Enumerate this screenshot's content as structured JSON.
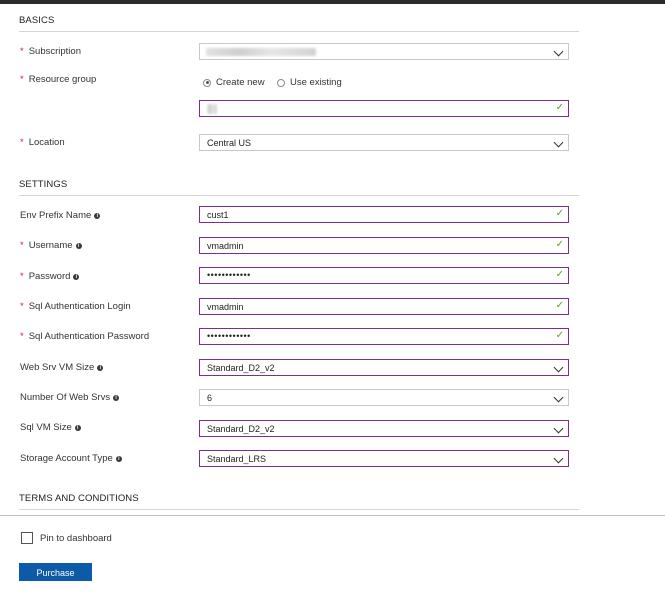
{
  "basics": {
    "title": "BASICS",
    "subscription": {
      "label": "Subscription"
    },
    "resource_group": {
      "label": "Resource group",
      "option_new": "Create new",
      "option_existing": "Use existing"
    },
    "location": {
      "label": "Location",
      "value": "Central US"
    }
  },
  "settings": {
    "title": "SETTINGS",
    "env_prefix": {
      "label": "Env Prefix Name",
      "value": "cust1"
    },
    "username": {
      "label": "Username",
      "value": "vmadmin"
    },
    "password": {
      "label": "Password",
      "value": "••••••••••••"
    },
    "sql_login": {
      "label": "Sql Authentication Login",
      "value": "vmadmin"
    },
    "sql_password": {
      "label": "Sql Authentication Password",
      "value": "••••••••••••"
    },
    "web_vm_size": {
      "label": "Web Srv VM Size",
      "value": "Standard_D2_v2"
    },
    "num_web_srvs": {
      "label": "Number Of Web Srvs",
      "value": "6"
    },
    "sql_vm_size": {
      "label": "Sql VM Size",
      "value": "Standard_D2_v2"
    },
    "storage_type": {
      "label": "Storage Account Type",
      "value": "Standard_LRS"
    }
  },
  "terms": {
    "title": "TERMS AND CONDITIONS"
  },
  "footer": {
    "pin_label": "Pin to dashboard",
    "purchase_label": "Purchase"
  },
  "glyphs": {
    "required": "*",
    "info": "i",
    "check": "✓"
  },
  "colors": {
    "accent_border": "#7a2f8e",
    "valid_check": "#5c9e2a",
    "button": "#0b5ba8",
    "required": "#c4262e"
  }
}
